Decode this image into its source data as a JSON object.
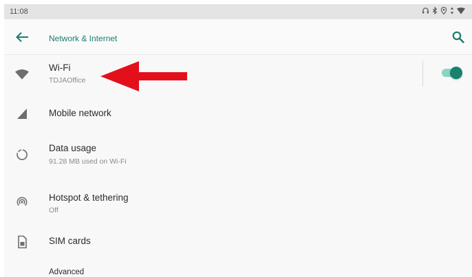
{
  "status_bar": {
    "time": "11:08",
    "icons": [
      "headphones-icon",
      "bluetooth-icon",
      "location-icon",
      "data-transfer-icon",
      "wifi-signal-icon"
    ]
  },
  "app_bar": {
    "title": "Network & Internet",
    "back_icon": "arrow-left-icon",
    "search_icon": "search-icon"
  },
  "settings": [
    {
      "id": "wifi",
      "label": "Wi-Fi",
      "summary": "TDJAOffice",
      "icon": "wifi-icon",
      "toggle_on": true
    },
    {
      "id": "mobile-network",
      "label": "Mobile network",
      "summary": "",
      "icon": "cell-signal-icon"
    },
    {
      "id": "data-usage",
      "label": "Data usage",
      "summary": "91.28 MB used on Wi-Fi",
      "icon": "data-usage-icon"
    },
    {
      "id": "hotspot",
      "label": "Hotspot & tethering",
      "summary": "Off",
      "icon": "hotspot-icon"
    },
    {
      "id": "sim-cards",
      "label": "SIM cards",
      "summary": "",
      "icon": "sim-card-icon"
    },
    {
      "id": "advanced",
      "label": "Advanced",
      "summary": "",
      "icon": "chevron-down-icon"
    }
  ],
  "annotation": {
    "type": "red-arrow-pointing-left",
    "color": "#e3101c"
  },
  "colors": {
    "accent": "#1a7d6b",
    "toggle_thumb": "#17826e",
    "toggle_track": "#8fd3c2",
    "icon_gray": "#6e6e6e"
  }
}
